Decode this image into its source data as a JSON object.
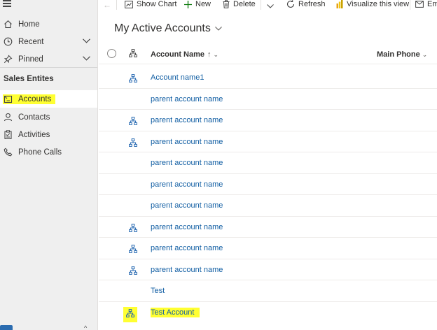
{
  "sidebar": {
    "hamburger_icon": "hamburger-icon",
    "items": [
      {
        "label": "Home",
        "icon": "home-icon"
      },
      {
        "label": "Recent",
        "icon": "clock-icon"
      },
      {
        "label": "Pinned",
        "icon": "pin-icon"
      }
    ],
    "section_title": "Sales Entites",
    "entities": [
      {
        "label": "Accounts",
        "icon": "accounts-icon",
        "selected": true,
        "highlighted": true
      },
      {
        "label": "Contacts",
        "icon": "person-icon"
      },
      {
        "label": "Activities",
        "icon": "clipboard-icon"
      },
      {
        "label": "Phone Calls",
        "icon": "phone-icon"
      }
    ]
  },
  "commandbar": {
    "show_chart": "Show Chart",
    "new": "New",
    "delete": "Delete",
    "refresh": "Refresh",
    "visualize": "Visualize this view",
    "email": "Em"
  },
  "view": {
    "title": "My Active Accounts",
    "columns": {
      "account_name": "Account Name",
      "sort_arrow": "↑",
      "main_phone": "Main Phone"
    }
  },
  "rows": [
    {
      "name": "Account name1",
      "hierarchy": true
    },
    {
      "name": "parent account name",
      "hierarchy": false
    },
    {
      "name": "parent account name",
      "hierarchy": true
    },
    {
      "name": "parent account name",
      "hierarchy": true
    },
    {
      "name": "parent account name",
      "hierarchy": false
    },
    {
      "name": "parent account name",
      "hierarchy": false
    },
    {
      "name": "parent account name",
      "hierarchy": false
    },
    {
      "name": "parent account name",
      "hierarchy": true
    },
    {
      "name": "parent account name",
      "hierarchy": true
    },
    {
      "name": "parent account name",
      "hierarchy": true
    },
    {
      "name": "Test",
      "hierarchy": false
    },
    {
      "name": "Test Account",
      "hierarchy": true,
      "highlighted": true
    }
  ],
  "colors": {
    "link": "#115ea3",
    "highlight": "#ffff32",
    "hierarchy_icon": "#2266b0",
    "new_icon": "#107c10",
    "visualize_icon": "#e8a317"
  }
}
